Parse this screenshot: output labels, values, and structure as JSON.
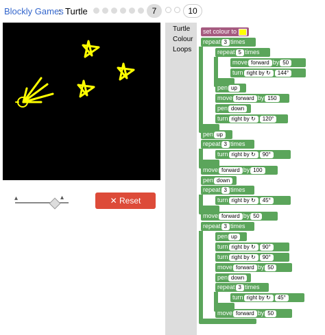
{
  "header": {
    "games_link": "Blockly Games",
    "separator": ":",
    "app_name": "Turtle",
    "current_level": "7",
    "last_level": "10"
  },
  "controls": {
    "reset_label": "Reset"
  },
  "toolbox": {
    "categories": [
      "Turtle",
      "Colour",
      "Loops"
    ]
  },
  "blocks": {
    "set_colour": "set colour to",
    "repeat": "repeat",
    "times": "times",
    "do": "do",
    "move": "move",
    "forward": "forward",
    "by": "by",
    "turn": "turn",
    "right_by": "right by ↻",
    "pen": "pen",
    "up": "up",
    "down": "down",
    "n3": "3",
    "n5": "5",
    "n50": "50",
    "n144": "144°",
    "n150": "150",
    "n120": "120°",
    "n90": "90°",
    "n100": "100",
    "n45": "45°"
  },
  "colors": {
    "turtle_green": "#5ba55b",
    "colour_pink": "#a55b80",
    "pen_yellow": "#ffff00",
    "reset_red": "#dd4b39"
  }
}
